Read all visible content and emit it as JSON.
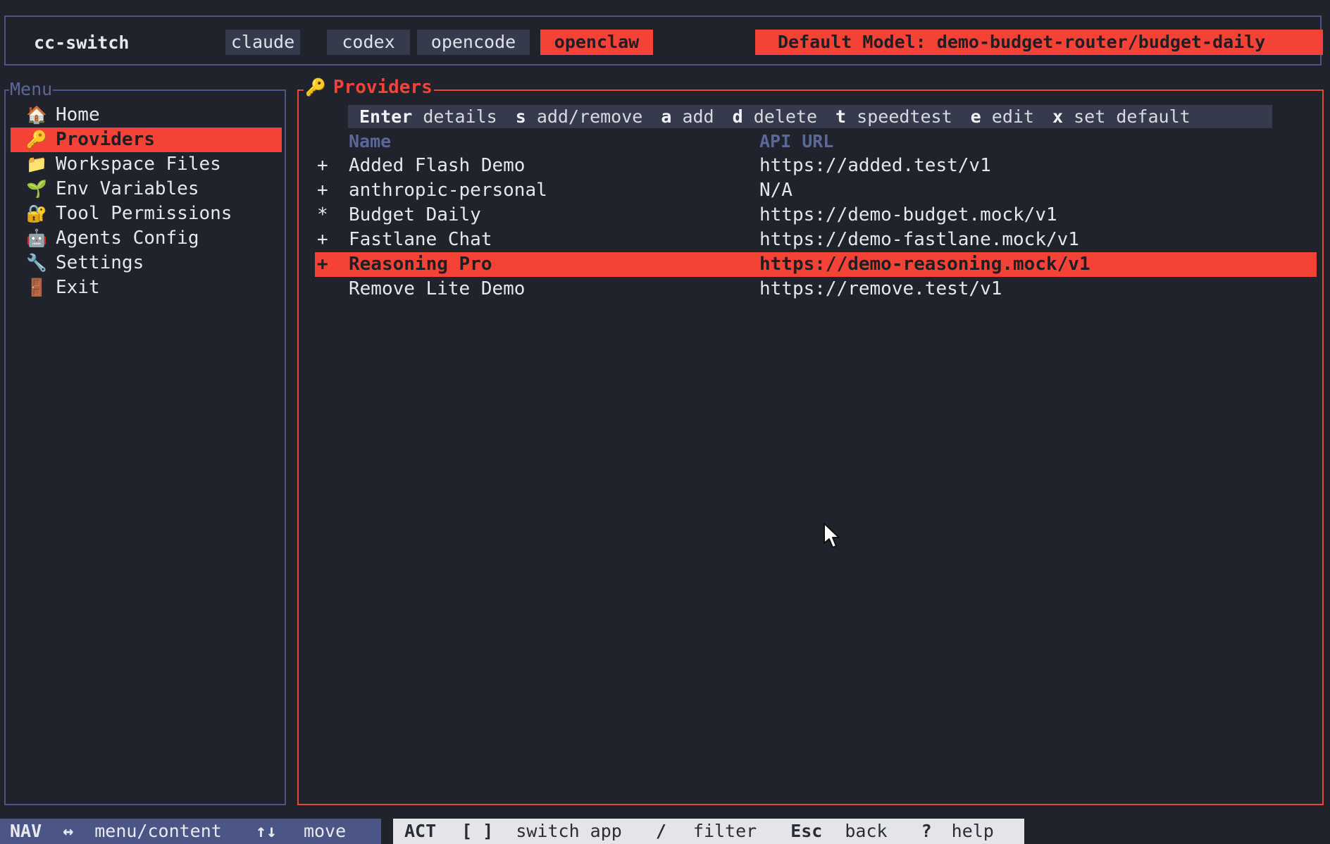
{
  "header": {
    "app_title": "cc-switch",
    "tabs": [
      {
        "label": "claude",
        "active": false
      },
      {
        "label": "codex",
        "active": false
      },
      {
        "label": "opencode",
        "active": false
      },
      {
        "label": "openclaw",
        "active": true
      }
    ],
    "default_model": "Default Model: demo-budget-router/budget-daily"
  },
  "menu": {
    "title": "Menu",
    "items": [
      {
        "label": "Home",
        "icon": "house-icon",
        "glyph": "🏠",
        "active": false
      },
      {
        "label": "Providers",
        "icon": "key-icon",
        "glyph": "🔑",
        "active": true
      },
      {
        "label": "Workspace Files",
        "icon": "folder-icon",
        "glyph": "📁",
        "active": false
      },
      {
        "label": "Env Variables",
        "icon": "seedling-icon",
        "glyph": "🌱",
        "active": false
      },
      {
        "label": "Tool Permissions",
        "icon": "lock-icon",
        "glyph": "🔐",
        "active": false
      },
      {
        "label": "Agents Config",
        "icon": "robot-icon",
        "glyph": "🤖",
        "active": false
      },
      {
        "label": "Settings",
        "icon": "wrench-icon",
        "glyph": "🔧",
        "active": false
      },
      {
        "label": "Exit",
        "icon": "door-icon",
        "glyph": "🚪",
        "active": false
      }
    ]
  },
  "providers": {
    "title": "Providers",
    "title_icon": "key-icon",
    "hints": [
      {
        "key": "Enter",
        "desc": "details"
      },
      {
        "key": "s",
        "desc": "add/remove"
      },
      {
        "key": "a",
        "desc": "add"
      },
      {
        "key": "d",
        "desc": "delete"
      },
      {
        "key": "t",
        "desc": "speedtest"
      },
      {
        "key": "e",
        "desc": "edit"
      },
      {
        "key": "x",
        "desc": "set default"
      }
    ],
    "columns": {
      "name": "Name",
      "api_url": "API URL"
    },
    "rows": [
      {
        "mark": "+",
        "name": "Added Flash Demo",
        "url": "https://added.test/v1",
        "selected": false
      },
      {
        "mark": "+",
        "name": "anthropic-personal",
        "url": "N/A",
        "selected": false
      },
      {
        "mark": "*",
        "name": "Budget Daily",
        "url": "https://demo-budget.mock/v1",
        "selected": false
      },
      {
        "mark": "+",
        "name": "Fastlane Chat",
        "url": "https://demo-fastlane.mock/v1",
        "selected": false
      },
      {
        "mark": "+",
        "name": "Reasoning Pro",
        "url": "https://demo-reasoning.mock/v1",
        "selected": true
      },
      {
        "mark": "",
        "name": "Remove Lite Demo",
        "url": "https://remove.test/v1",
        "selected": false
      }
    ]
  },
  "status": {
    "nav_mode": "NAV",
    "nav_hints": [
      {
        "key": "↔",
        "desc": "menu/content"
      },
      {
        "key": "↑↓",
        "desc": "move"
      }
    ],
    "act_mode": "ACT",
    "act_hints": [
      {
        "key": "[ ]",
        "desc": "switch app"
      },
      {
        "key": "/",
        "desc": "filter"
      },
      {
        "key": "Esc",
        "desc": "back"
      },
      {
        "key": "?",
        "desc": "help"
      }
    ]
  },
  "colors": {
    "accent": "#f44336",
    "border_blue": "#4c5686",
    "background": "#20232b",
    "chip_bg": "#353a4c"
  }
}
